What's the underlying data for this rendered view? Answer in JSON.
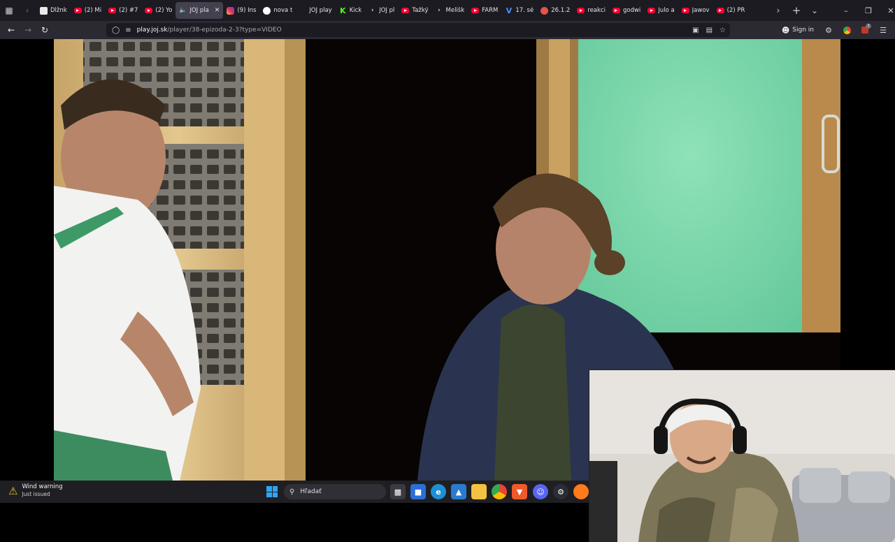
{
  "browser": {
    "tabs": [
      {
        "label": "Dĺžnk",
        "favicon": "document-icon"
      },
      {
        "label": "(2) Mi",
        "favicon": "youtube-icon"
      },
      {
        "label": "(2) #7",
        "favicon": "youtube-icon"
      },
      {
        "label": "(2) Yo",
        "favicon": "youtube-icon"
      },
      {
        "label": "JOJ pla",
        "favicon": "speaker-icon",
        "active": true
      },
      {
        "label": "(9) Ins",
        "favicon": "instagram-icon"
      },
      {
        "label": "nova t",
        "favicon": "globe-icon"
      },
      {
        "label": "JOJ play",
        "favicon": "none"
      },
      {
        "label": "Kick",
        "favicon": "kick-icon"
      },
      {
        "label": "JOJ pl",
        "favicon": "joj-icon"
      },
      {
        "label": "Ťažký",
        "favicon": "youtube-icon"
      },
      {
        "label": "Melišk",
        "favicon": "joj-icon"
      },
      {
        "label": "FARM",
        "favicon": "youtube-icon"
      },
      {
        "label": "17. sé",
        "favicon": "v-icon"
      },
      {
        "label": "26.1.2",
        "favicon": "red-circle-icon"
      },
      {
        "label": "reakci",
        "favicon": "youtube-icon"
      },
      {
        "label": "godwi",
        "favicon": "youtube-icon"
      },
      {
        "label": "Julo a",
        "favicon": "youtube-icon"
      },
      {
        "label": "Jawov",
        "favicon": "youtube-icon"
      },
      {
        "label": "(2) PR",
        "favicon": "youtube-icon"
      }
    ],
    "url_domain": "play.joj.sk",
    "url_path": "/player/38-epizoda-2-3?type=VIDEO",
    "sign_in_label": "Sign in",
    "extension_badge": "7"
  },
  "taskbar": {
    "notification_title": "Wind warning",
    "notification_subtitle": "Just issued",
    "search_label": "Hľadať"
  }
}
